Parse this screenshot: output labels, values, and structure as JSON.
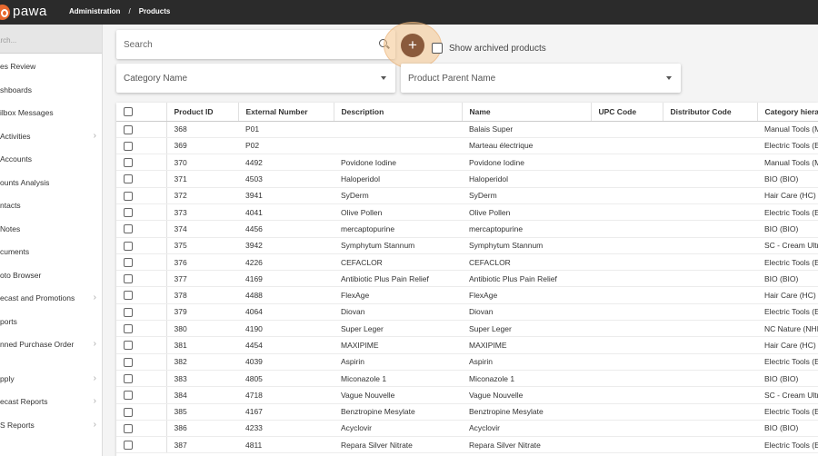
{
  "app": {
    "logo_text": "pawa"
  },
  "breadcrumb": {
    "items": [
      "Administration",
      "/",
      "Products"
    ]
  },
  "sidebar": {
    "search_placeholder": "arch...",
    "items": [
      {
        "label": "es Review",
        "chevron": false
      },
      {
        "label": "shboards",
        "chevron": false
      },
      {
        "label": "ilbox Messages",
        "chevron": false
      },
      {
        "label": "Activities",
        "chevron": true
      },
      {
        "label": "Accounts",
        "chevron": false
      },
      {
        "label": "ounts Analysis",
        "chevron": false
      },
      {
        "label": "ntacts",
        "chevron": false
      },
      {
        "label": "Notes",
        "chevron": false
      },
      {
        "label": "cuments",
        "chevron": false
      },
      {
        "label": "oto Browser",
        "chevron": false
      },
      {
        "label": "ecast and Promotions",
        "chevron": true
      },
      {
        "label": "ports",
        "chevron": false
      },
      {
        "label": "nned Purchase Order",
        "chevron": true
      },
      {
        "label": "pply",
        "chevron": true
      },
      {
        "label": "ecast Reports",
        "chevron": true
      },
      {
        "label": "S Reports",
        "chevron": true
      }
    ]
  },
  "controls": {
    "search_placeholder": "Search",
    "add_symbol": "+",
    "show_archived_label": "Show archived products",
    "category_select": "Category Name",
    "parent_select": "Product Parent Name"
  },
  "table": {
    "columns": [
      "Product ID",
      "External Number",
      "Description",
      "Name",
      "UPC Code",
      "Distributor Code",
      "Category hiera"
    ],
    "rows": [
      [
        "368",
        "P01",
        "",
        "Balais Super",
        "",
        "",
        "Manual Tools (M"
      ],
      [
        "369",
        "P02",
        "",
        "Marteau électrique",
        "",
        "",
        "Electric Tools (E"
      ],
      [
        "370",
        "4492",
        "Povidone Iodine",
        "Povidone Iodine",
        "",
        "",
        "Manual Tools (M"
      ],
      [
        "371",
        "4503",
        "Haloperidol",
        "Haloperidol",
        "",
        "",
        "BIO (BIO)"
      ],
      [
        "372",
        "3941",
        "SyDerm",
        "SyDerm",
        "",
        "",
        "Hair Care (HC)"
      ],
      [
        "373",
        "4041",
        "Olive Pollen",
        "Olive Pollen",
        "",
        "",
        "Electric Tools (E"
      ],
      [
        "374",
        "4456",
        "mercaptopurine",
        "mercaptopurine",
        "",
        "",
        "BIO (BIO)"
      ],
      [
        "375",
        "3942",
        "Symphytum Stannum",
        "Symphytum Stannum",
        "",
        "",
        "SC - Cream Ultr"
      ],
      [
        "376",
        "4226",
        "CEFACLOR",
        "CEFACLOR",
        "",
        "",
        "Electric Tools (E"
      ],
      [
        "377",
        "4169",
        "Antibiotic Plus Pain Relief",
        "Antibiotic Plus Pain Relief",
        "",
        "",
        "BIO (BIO)"
      ],
      [
        "378",
        "4488",
        "FlexAge",
        "FlexAge",
        "",
        "",
        "Hair Care (HC)"
      ],
      [
        "379",
        "4064",
        "Diovan",
        "Diovan",
        "",
        "",
        "Electric Tools (E"
      ],
      [
        "380",
        "4190",
        "Super Leger",
        "Super Leger",
        "",
        "",
        "NC Nature (NHI"
      ],
      [
        "381",
        "4454",
        "MAXIPIME",
        "MAXIPIME",
        "",
        "",
        "Hair Care (HC)"
      ],
      [
        "382",
        "4039",
        "Aspirin",
        "Aspirin",
        "",
        "",
        "Electric Tools (E"
      ],
      [
        "383",
        "4805",
        "Miconazole 1",
        "Miconazole 1",
        "",
        "",
        "BIO (BIO)"
      ],
      [
        "384",
        "4718",
        "Vague Nouvelle",
        "Vague Nouvelle",
        "",
        "",
        "SC - Cream Ultr"
      ],
      [
        "385",
        "4167",
        "Benztropine Mesylate",
        "Benztropine Mesylate",
        "",
        "",
        "Electric Tools (E"
      ],
      [
        "386",
        "4233",
        "Acyclovir",
        "Acyclovir",
        "",
        "",
        "BIO (BIO)"
      ],
      [
        "387",
        "4811",
        "Repara Silver Nitrate",
        "Repara Silver Nitrate",
        "",
        "",
        "Electric Tools (E"
      ]
    ]
  }
}
